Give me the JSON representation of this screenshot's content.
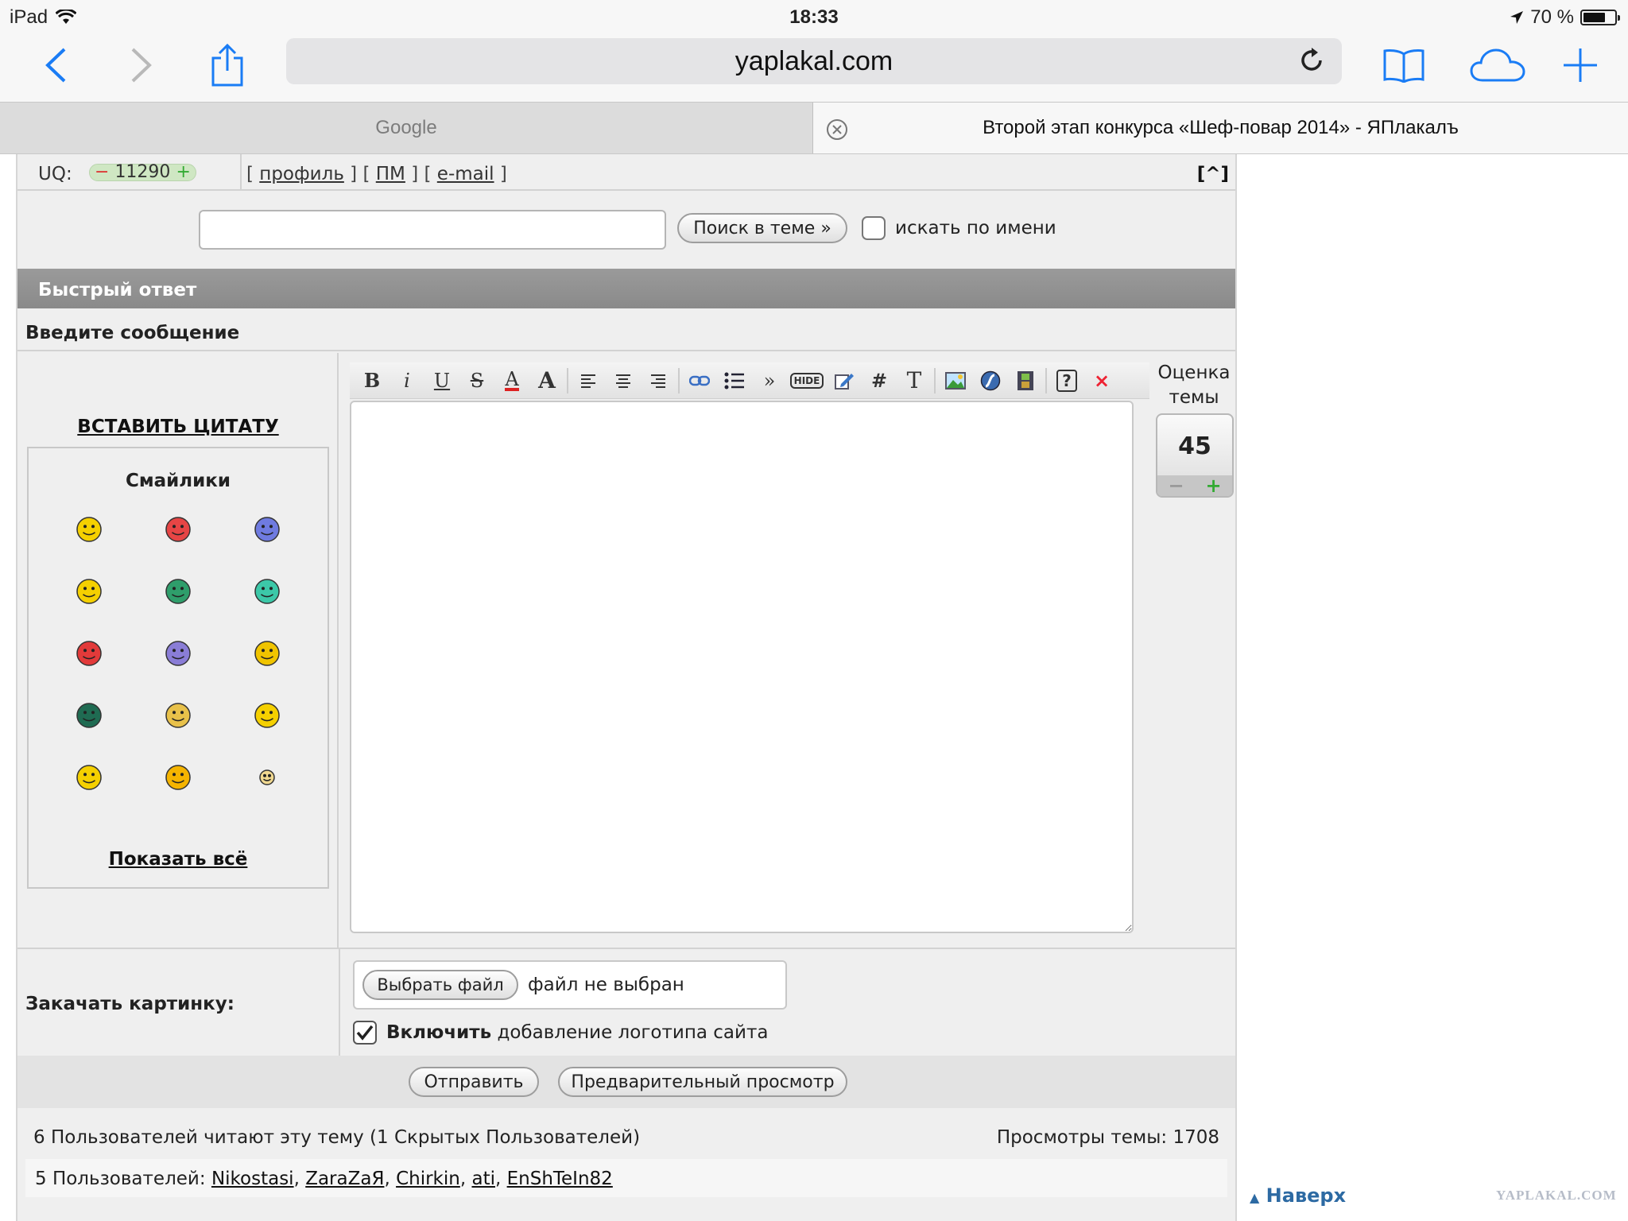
{
  "status": {
    "device": "iPad",
    "time": "18:33",
    "battery": "70 %",
    "battery_fraction": 0.7
  },
  "safari": {
    "url": "yaplakal.com",
    "icons": [
      "back-icon",
      "forward-icon",
      "share-icon",
      "reload-icon",
      "bookmarks-icon",
      "icloud-tabs-icon",
      "new-tab-icon"
    ],
    "accent": "#1a7cf5"
  },
  "tabs": [
    {
      "label": "Google",
      "active": false
    },
    {
      "label": "Второй этап конкурса «Шеф-повар 2014» - ЯПлакалъ",
      "active": true
    }
  ],
  "userbar": {
    "uq_label": "UQ:",
    "uq_value": "11290",
    "uq_minus": "−",
    "uq_plus": "+",
    "link_profile": "профиль",
    "link_pm": "ПМ",
    "link_email": "e-mail",
    "to_top": "[^]"
  },
  "search": {
    "value": "",
    "button": "Поиск в теме »",
    "by_name": "искать по имени",
    "by_name_checked": false
  },
  "quick_reply": {
    "header": "Быстрый ответ",
    "enter_message": "Введите сообщение"
  },
  "left_panel": {
    "insert_quote": "ВСТАВИТЬ ЦИТАТУ",
    "smileys_title": "Смайлики",
    "show_all": "Показать всё"
  },
  "smileys": [
    "cool-smiley-icon",
    "in-love-smiley-icon",
    "sad-smiley-icon",
    "thinking-smiley-icon",
    "gun-smiley-icon",
    "teal-smiley-icon",
    "shooting-smiley-icon",
    "purple-smiley-icon",
    "rock-smiley-icon",
    "hat-smiley-icon",
    "clapping-smiley-icon",
    "girl-smiley-icon",
    "medal-smiley-icon",
    "laughing-smiley-icon",
    "star-smiley-icon"
  ],
  "editor": {
    "buttons": [
      "B",
      "i",
      "U",
      "S",
      "A",
      "A",
      "left",
      "center",
      "right",
      "link",
      "list",
      "»",
      "HIDE",
      "edit",
      "#",
      "T",
      "img",
      "flash",
      "video",
      "?",
      "×"
    ],
    "message": ""
  },
  "rating": {
    "label": "Оценка темы",
    "value": "45",
    "minus": "−",
    "plus": "+"
  },
  "upload": {
    "label": "Закачать картинку:",
    "choose": "Выбрать файл",
    "none": "файл не выбран",
    "logo_bold": "Включить",
    "logo_rest": " добавление логотипа сайта",
    "logo_checked": true
  },
  "actions": {
    "send": "Отправить",
    "preview": "Предварительный просмотр"
  },
  "footer": {
    "readers": "6 Пользователей читают эту тему (1 Скрытых Пользователей)",
    "views": "Просмотры темы: 1708",
    "users_prefix": "5 Пользователей: ",
    "users": [
      "Nikostasi",
      "ZaraZaЯ",
      "Chirkin",
      "ati",
      "EnShTeIn82"
    ],
    "to_top": "Наверх",
    "brand": "YAPLAKAL.COM"
  }
}
